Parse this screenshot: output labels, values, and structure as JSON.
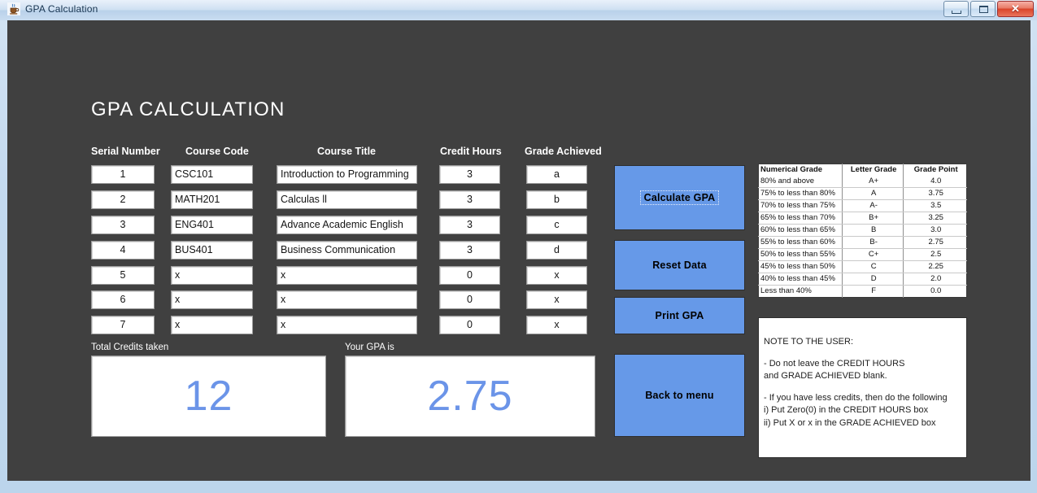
{
  "window": {
    "title": "GPA Calculation",
    "icon": "java-coffee-cup-icon",
    "controls": {
      "minimize": "–",
      "maximize": "□",
      "close": "✕"
    }
  },
  "page": {
    "heading": "GPA CALCULATION",
    "background_color": "#404040",
    "accent_color": "#6699e8",
    "result_text_color": "#6b94e8"
  },
  "table": {
    "headers": {
      "serial": "Serial Number",
      "code": "Course Code",
      "title": "Course Title",
      "credits": "Credit Hours",
      "grade": "Grade Achieved"
    },
    "rows": [
      {
        "serial": "1",
        "code": "CSC101",
        "title": "Introduction to Programming",
        "credits": "3",
        "grade": "a"
      },
      {
        "serial": "2",
        "code": "MATH201",
        "title": "Calculas ll",
        "credits": "3",
        "grade": "b"
      },
      {
        "serial": "3",
        "code": "ENG401",
        "title": "Advance Academic English",
        "credits": "3",
        "grade": "c"
      },
      {
        "serial": "4",
        "code": "BUS401",
        "title": "Business Communication",
        "credits": "3",
        "grade": "d"
      },
      {
        "serial": "5",
        "code": "x",
        "title": "x",
        "credits": "0",
        "grade": "x"
      },
      {
        "serial": "6",
        "code": "x",
        "title": "x",
        "credits": "0",
        "grade": "x"
      },
      {
        "serial": "7",
        "code": "x",
        "title": "x",
        "credits": "0",
        "grade": "x"
      }
    ]
  },
  "buttons": {
    "calculate": "Calculate GPA",
    "reset": "Reset Data",
    "print": "Print GPA",
    "back": "Back to menu"
  },
  "results": {
    "credits_label": "Total Credits taken",
    "credits_value": "12",
    "gpa_label": "Your GPA is",
    "gpa_value": "2.75"
  },
  "grade_scale": {
    "headers": [
      "Numerical Grade",
      "Letter Grade",
      "Grade Point"
    ],
    "rows": [
      [
        "80% and above",
        "A+",
        "4.0"
      ],
      [
        "75% to less than 80%",
        "A",
        "3.75"
      ],
      [
        "70% to less than 75%",
        "A-",
        "3.5"
      ],
      [
        "65% to less than 70%",
        "B+",
        "3.25"
      ],
      [
        "60% to less than 65%",
        "B",
        "3.0"
      ],
      [
        "55% to less than 60%",
        "B-",
        "2.75"
      ],
      [
        "50% to less than 55%",
        "C+",
        "2.5"
      ],
      [
        "45% to less than 50%",
        "C",
        "2.25"
      ],
      [
        "40% to less than 45%",
        "D",
        "2.0"
      ],
      [
        "Less than 40%",
        "F",
        "0.0"
      ]
    ]
  },
  "note": {
    "title": "NOTE TO THE USER:",
    "line1": "- Do not leave the CREDIT HOURS",
    "line2": "and GRADE ACHIEVED blank.",
    "line3": "- If you have less credits, then do the following",
    "line4": "i) Put Zero(0) in the CREDIT HOURS box",
    "line5": "ii) Put X or x in the GRADE ACHIEVED box"
  }
}
